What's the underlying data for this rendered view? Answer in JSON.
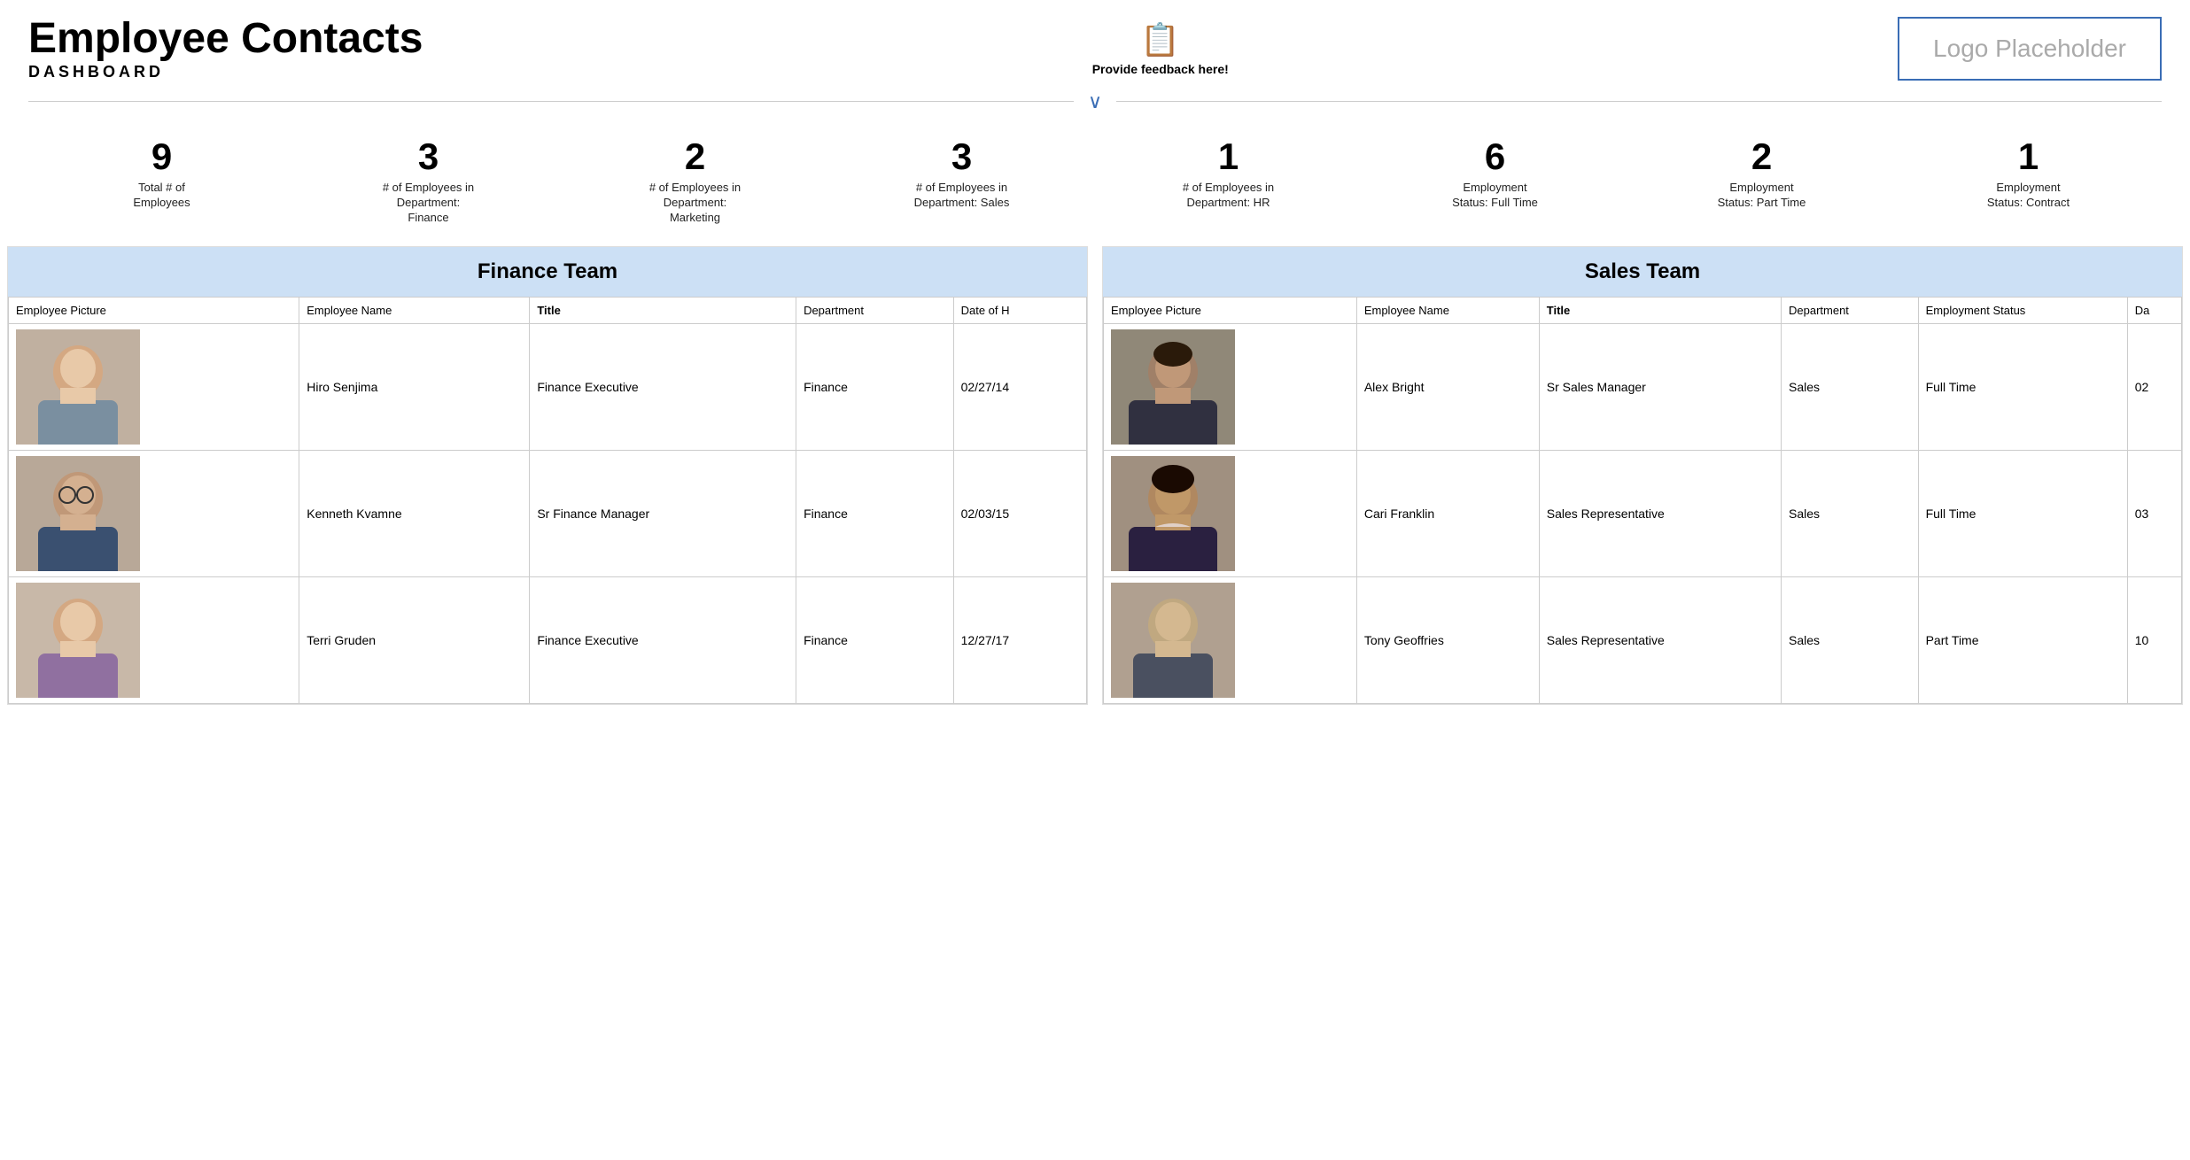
{
  "header": {
    "title": "Employee Contacts",
    "subtitle": "DASHBOARD",
    "feedback_label": "Provide feedback here!",
    "logo_text": "Logo Placeholder"
  },
  "stats": [
    {
      "number": "9",
      "label": "Total # of\nEmployees"
    },
    {
      "number": "3",
      "label": "# of Employees in\nDepartment:\nFinance"
    },
    {
      "number": "2",
      "label": "# of Employees in\nDepartment:\nMarketing"
    },
    {
      "number": "3",
      "label": "# of Employees in\nDepartment: Sales"
    },
    {
      "number": "1",
      "label": "# of Employees in\nDepartment: HR"
    },
    {
      "number": "6",
      "label": "Employment\nStatus: Full Time"
    },
    {
      "number": "2",
      "label": "Employment\nStatus: Part Time"
    },
    {
      "number": "1",
      "label": "Employment\nStatus: Contract"
    }
  ],
  "finance_team": {
    "header": "Finance Team",
    "columns": [
      "Employee Picture",
      "Employee Name",
      "Title",
      "Department",
      "Date of H"
    ],
    "bold_columns": [
      2
    ],
    "rows": [
      {
        "name": "Hiro Senjima",
        "title": "Finance Executive",
        "department": "Finance",
        "date": "02/27/14",
        "photo": "hiro"
      },
      {
        "name": "Kenneth Kvamne",
        "title": "Sr Finance Manager",
        "department": "Finance",
        "date": "02/03/15",
        "photo": "kenneth"
      },
      {
        "name": "Terri Gruden",
        "title": "Finance Executive",
        "department": "Finance",
        "date": "12/27/17",
        "photo": "terri"
      }
    ]
  },
  "sales_team": {
    "header": "Sales Team",
    "columns": [
      "Employee Picture",
      "Employee Name",
      "Title",
      "Department",
      "Employment Status",
      "Da"
    ],
    "bold_columns": [
      2
    ],
    "rows": [
      {
        "name": "Alex Bright",
        "title": "Sr Sales Manager",
        "department": "Sales",
        "employment_status": "Full Time",
        "date": "02",
        "photo": "alex"
      },
      {
        "name": "Cari Franklin",
        "title": "Sales Representative",
        "department": "Sales",
        "employment_status": "Full Time",
        "date": "03",
        "photo": "cari"
      },
      {
        "name": "Tony Geoffries",
        "title": "Sales Representative",
        "department": "Sales",
        "employment_status": "Part Time",
        "date": "10",
        "photo": "tony"
      }
    ]
  }
}
